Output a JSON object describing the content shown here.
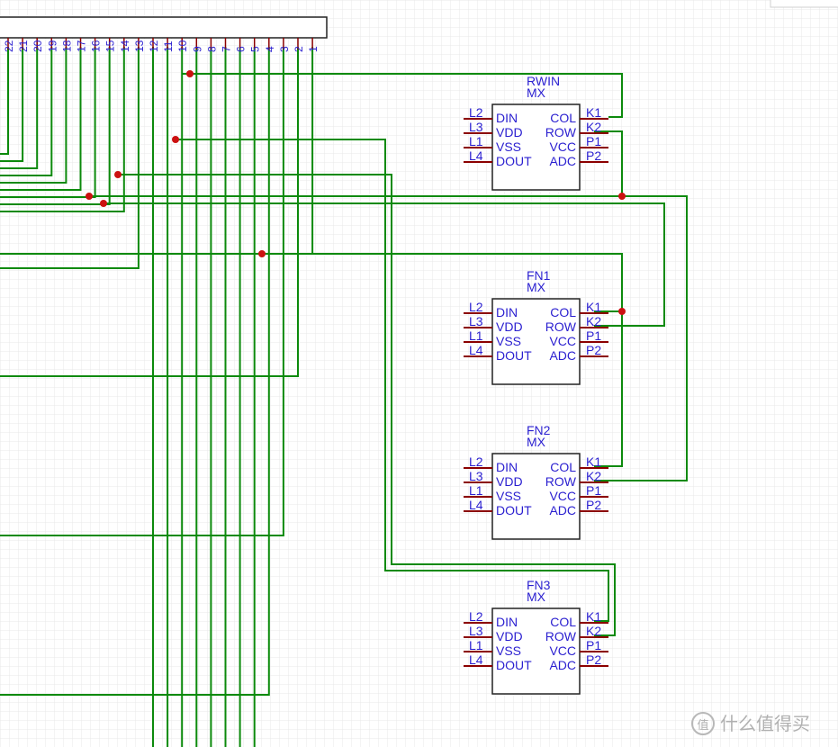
{
  "header_pins": [
    "22",
    "21",
    "20",
    "19",
    "18",
    "17",
    "16",
    "15",
    "14",
    "13",
    "12",
    "11",
    "10",
    "9",
    "8",
    "7",
    "6",
    "5",
    "4",
    "3",
    "2",
    "1"
  ],
  "components": [
    {
      "name": "RWIN",
      "type": "MX",
      "left_pins": [
        "L2",
        "L3",
        "L1",
        "L4"
      ],
      "left_labels": [
        "DIN",
        "VDD",
        "VSS",
        "DOUT"
      ],
      "right_labels": [
        "COL",
        "ROW",
        "VCC",
        "ADC"
      ],
      "right_pins": [
        "K1",
        "K2",
        "P1",
        "P2"
      ]
    },
    {
      "name": "FN1",
      "type": "MX",
      "left_pins": [
        "L2",
        "L3",
        "L1",
        "L4"
      ],
      "left_labels": [
        "DIN",
        "VDD",
        "VSS",
        "DOUT"
      ],
      "right_labels": [
        "COL",
        "ROW",
        "VCC",
        "ADC"
      ],
      "right_pins": [
        "K1",
        "K2",
        "P1",
        "P2"
      ]
    },
    {
      "name": "FN2",
      "type": "MX",
      "left_pins": [
        "L2",
        "L3",
        "L1",
        "L4"
      ],
      "left_labels": [
        "DIN",
        "VDD",
        "VSS",
        "DOUT"
      ],
      "right_labels": [
        "COL",
        "ROW",
        "VCC",
        "ADC"
      ],
      "right_pins": [
        "K1",
        "K2",
        "P1",
        "P2"
      ]
    },
    {
      "name": "FN3",
      "type": "MX",
      "left_pins": [
        "L2",
        "L3",
        "L1",
        "L4"
      ],
      "left_labels": [
        "DIN",
        "VDD",
        "VSS",
        "DOUT"
      ],
      "right_labels": [
        "COL",
        "ROW",
        "VCC",
        "ADC"
      ],
      "right_pins": [
        "K1",
        "K2",
        "P1",
        "P2"
      ]
    }
  ],
  "watermark": {
    "text": "什么值得买",
    "logo": "值"
  },
  "colors": {
    "wire": "#0c8a0c",
    "pin": "#8b0000",
    "text": "#2a1fd0",
    "junction": "#cc1111",
    "grid": "#e6e6e6"
  }
}
